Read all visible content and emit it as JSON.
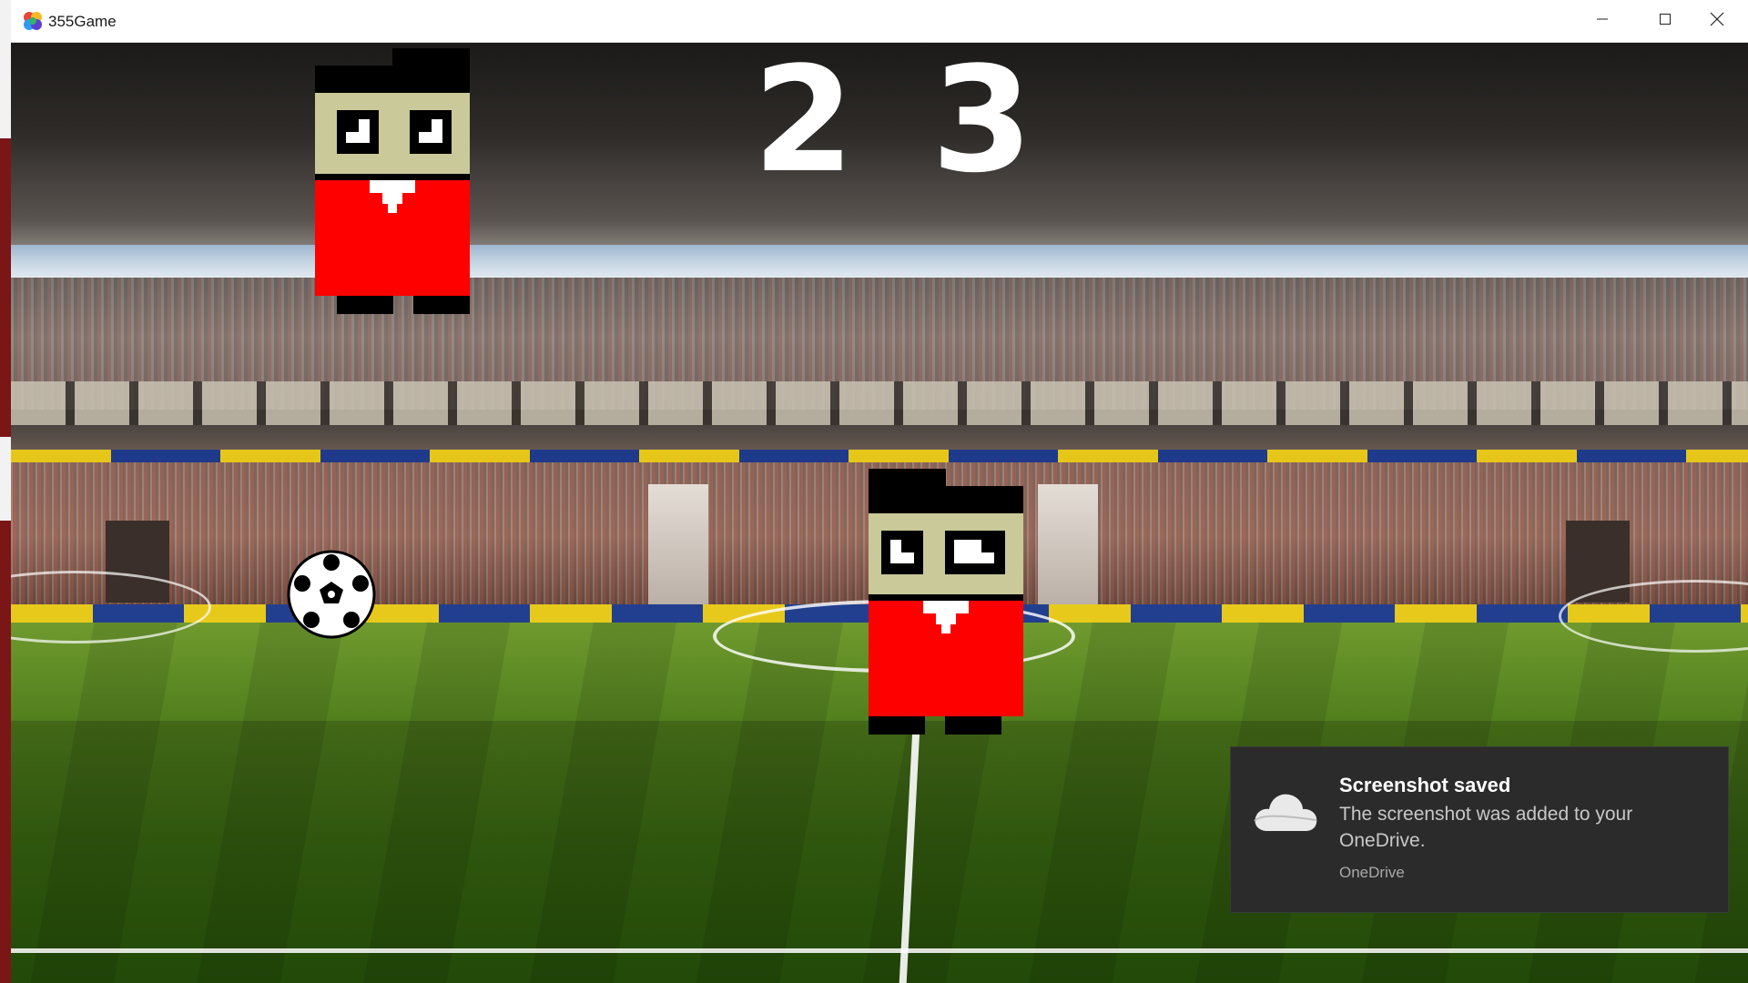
{
  "window": {
    "title": "355Game",
    "icon": "app-color-logo-icon"
  },
  "controls": {
    "minimize_icon": "minimize-icon",
    "maximize_icon": "maximize-icon",
    "close_icon": "close-icon"
  },
  "score": {
    "left": "2",
    "right": "3"
  },
  "players": [
    {
      "name": "player-one",
      "jersey_color": "#ff0000",
      "skin_color": "#c9c99a",
      "hair_color": "#000000"
    },
    {
      "name": "player-two",
      "jersey_color": "#ff0000",
      "skin_color": "#c9c99a",
      "hair_color": "#000000"
    }
  ],
  "ball": {
    "icon": "soccer-ball-icon"
  },
  "toast": {
    "title": "Screenshot saved",
    "body": "The screenshot was added to your OneDrive.",
    "source": "OneDrive",
    "icon": "onedrive-cloud-icon"
  }
}
